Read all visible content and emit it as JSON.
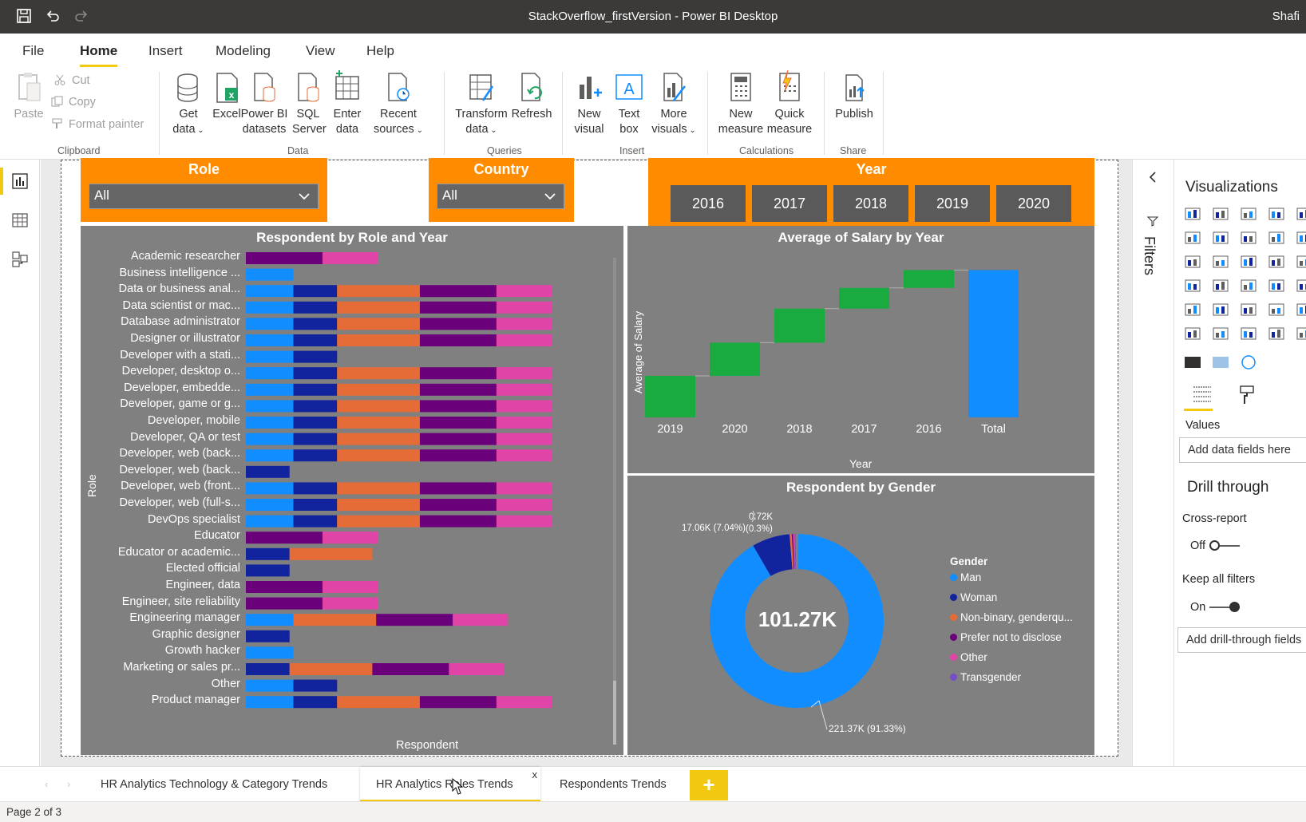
{
  "window": {
    "title": "StackOverflow_firstVersion - Power BI Desktop",
    "user": "Shafi"
  },
  "menu": {
    "tabs": [
      "File",
      "Home",
      "Insert",
      "Modeling",
      "View",
      "Help"
    ],
    "active": "Home"
  },
  "ribbon": {
    "clipboard": {
      "paste": "Paste",
      "cut": "Cut",
      "copy": "Copy",
      "format_painter": "Format painter",
      "label": "Clipboard"
    },
    "data": {
      "get_data": [
        "Get",
        "data"
      ],
      "excel": "Excel",
      "powerbi": [
        "Power BI",
        "datasets"
      ],
      "sql": [
        "SQL",
        "Server"
      ],
      "enter": [
        "Enter",
        "data"
      ],
      "recent": [
        "Recent",
        "sources"
      ],
      "label": "Data"
    },
    "queries": {
      "transform": [
        "Transform",
        "data"
      ],
      "refresh": "Refresh",
      "label": "Queries"
    },
    "insert": {
      "new_visual": [
        "New",
        "visual"
      ],
      "text_box": [
        "Text",
        "box"
      ],
      "more": [
        "More",
        "visuals"
      ],
      "label": "Insert"
    },
    "calc": {
      "new_measure": [
        "New",
        "measure"
      ],
      "quick_measure": [
        "Quick",
        "measure"
      ],
      "label": "Calculations"
    },
    "share": {
      "publish": "Publish",
      "label": "Share"
    }
  },
  "slicers": {
    "role": {
      "title": "Role",
      "value": "All"
    },
    "country": {
      "title": "Country",
      "value": "All"
    },
    "year": {
      "title": "Year",
      "options": [
        "2016",
        "2017",
        "2018",
        "2019",
        "2020"
      ]
    }
  },
  "colors": {
    "y2016": "#118dff",
    "y2017": "#12239e",
    "y2018": "#e66c37",
    "y2019": "#6b007b",
    "y2020": "#e044a7",
    "green": "#1aab40",
    "slicer_orange": "#ff8c00",
    "visual_bg": "#808080"
  },
  "role_chart": {
    "title": "Respondent by Role and Year",
    "xlabel": "Respondent",
    "ylabel": "Role",
    "roles": [
      {
        "label": "Academic researcher",
        "segs": [
          [
            3,
            1.0
          ],
          [
            4,
            0.72
          ]
        ]
      },
      {
        "label": "Business intelligence ...",
        "segs": [
          [
            0,
            0.62
          ]
        ]
      },
      {
        "label": "Data or business anal...",
        "segs": [
          [
            0,
            0.62
          ],
          [
            1,
            0.57
          ],
          [
            2,
            1.08
          ],
          [
            3,
            1.0
          ],
          [
            4,
            0.72
          ]
        ]
      },
      {
        "label": "Data scientist or mac...",
        "segs": [
          [
            0,
            0.62
          ],
          [
            1,
            0.57
          ],
          [
            2,
            1.08
          ],
          [
            3,
            1.0
          ],
          [
            4,
            0.72
          ]
        ]
      },
      {
        "label": "Database administrator",
        "segs": [
          [
            0,
            0.62
          ],
          [
            1,
            0.57
          ],
          [
            2,
            1.08
          ],
          [
            3,
            1.0
          ],
          [
            4,
            0.72
          ]
        ]
      },
      {
        "label": "Designer or illustrator",
        "segs": [
          [
            0,
            0.62
          ],
          [
            1,
            0.57
          ],
          [
            2,
            1.08
          ],
          [
            3,
            1.0
          ],
          [
            4,
            0.72
          ]
        ]
      },
      {
        "label": "Developer with a stati...",
        "segs": [
          [
            0,
            0.62
          ],
          [
            1,
            0.57
          ]
        ]
      },
      {
        "label": "Developer, desktop o...",
        "segs": [
          [
            0,
            0.62
          ],
          [
            1,
            0.57
          ],
          [
            2,
            1.08
          ],
          [
            3,
            1.0
          ],
          [
            4,
            0.72
          ]
        ]
      },
      {
        "label": "Developer, embedde...",
        "segs": [
          [
            0,
            0.62
          ],
          [
            1,
            0.57
          ],
          [
            2,
            1.08
          ],
          [
            3,
            1.0
          ],
          [
            4,
            0.72
          ]
        ]
      },
      {
        "label": "Developer, game or g...",
        "segs": [
          [
            0,
            0.62
          ],
          [
            1,
            0.57
          ],
          [
            2,
            1.08
          ],
          [
            3,
            1.0
          ],
          [
            4,
            0.72
          ]
        ]
      },
      {
        "label": "Developer, mobile",
        "segs": [
          [
            0,
            0.62
          ],
          [
            1,
            0.57
          ],
          [
            2,
            1.08
          ],
          [
            3,
            1.0
          ],
          [
            4,
            0.72
          ]
        ]
      },
      {
        "label": "Developer, QA or test",
        "segs": [
          [
            0,
            0.62
          ],
          [
            1,
            0.57
          ],
          [
            2,
            1.08
          ],
          [
            3,
            1.0
          ],
          [
            4,
            0.72
          ]
        ]
      },
      {
        "label": "Developer, web (back...",
        "segs": [
          [
            0,
            0.62
          ],
          [
            1,
            0.57
          ],
          [
            2,
            1.08
          ],
          [
            3,
            1.0
          ],
          [
            4,
            0.72
          ]
        ]
      },
      {
        "label": "Developer, web (back...",
        "segs": [
          [
            1,
            0.57
          ]
        ]
      },
      {
        "label": "Developer, web (front...",
        "segs": [
          [
            0,
            0.62
          ],
          [
            1,
            0.57
          ],
          [
            2,
            1.08
          ],
          [
            3,
            1.0
          ],
          [
            4,
            0.72
          ]
        ]
      },
      {
        "label": "Developer, web (full-s...",
        "segs": [
          [
            0,
            0.62
          ],
          [
            1,
            0.57
          ],
          [
            2,
            1.08
          ],
          [
            3,
            1.0
          ],
          [
            4,
            0.72
          ]
        ]
      },
      {
        "label": "DevOps specialist",
        "segs": [
          [
            0,
            0.62
          ],
          [
            1,
            0.57
          ],
          [
            2,
            1.08
          ],
          [
            3,
            1.0
          ],
          [
            4,
            0.72
          ]
        ]
      },
      {
        "label": "Educator",
        "segs": [
          [
            3,
            1.0
          ],
          [
            4,
            0.72
          ]
        ]
      },
      {
        "label": "Educator or academic...",
        "segs": [
          [
            1,
            0.57
          ],
          [
            2,
            1.08
          ]
        ]
      },
      {
        "label": "Elected official",
        "segs": [
          [
            1,
            0.57
          ]
        ]
      },
      {
        "label": "Engineer, data",
        "segs": [
          [
            3,
            1.0
          ],
          [
            4,
            0.72
          ]
        ]
      },
      {
        "label": "Engineer, site reliability",
        "segs": [
          [
            3,
            1.0
          ],
          [
            4,
            0.72
          ]
        ]
      },
      {
        "label": "Engineering manager",
        "segs": [
          [
            0,
            0.62
          ],
          [
            2,
            1.08
          ],
          [
            3,
            1.0
          ],
          [
            4,
            0.72
          ]
        ]
      },
      {
        "label": "Graphic designer",
        "segs": [
          [
            1,
            0.57
          ]
        ]
      },
      {
        "label": "Growth hacker",
        "segs": [
          [
            0,
            0.62
          ]
        ]
      },
      {
        "label": "Marketing or sales pr...",
        "segs": [
          [
            1,
            0.57
          ],
          [
            2,
            1.08
          ],
          [
            3,
            1.0
          ],
          [
            4,
            0.72
          ]
        ]
      },
      {
        "label": "Other",
        "segs": [
          [
            0,
            0.62
          ],
          [
            1,
            0.57
          ]
        ]
      },
      {
        "label": "Product manager",
        "segs": [
          [
            0,
            0.62
          ],
          [
            1,
            0.57
          ],
          [
            2,
            1.08
          ],
          [
            3,
            1.0
          ],
          [
            4,
            0.72
          ]
        ]
      }
    ]
  },
  "salary_chart": {
    "title": "Average of Salary by Year",
    "xlabel": "Year",
    "ylabel": "Average of Salary",
    "categories": [
      "2019",
      "2020",
      "2018",
      "2017",
      "2016",
      "Total"
    ],
    "steps": [
      [
        0,
        1
      ],
      [
        1,
        1.8
      ],
      [
        1.8,
        2.62
      ],
      [
        2.62,
        3.12
      ],
      [
        3.12,
        3.55
      ],
      [
        0,
        3.55
      ]
    ]
  },
  "gender_chart": {
    "title": "Respondent by Gender",
    "center_label": "101.27K",
    "legend_title": "Gender",
    "slices": [
      {
        "name": "Man",
        "share": 0.9133,
        "color": "#118dff"
      },
      {
        "name": "Woman",
        "share": 0.0704,
        "color": "#12239e"
      },
      {
        "name": "Non-binary, genderqu...",
        "share": 0.004,
        "color": "#e66c37"
      },
      {
        "name": "Prefer not to disclose",
        "share": 0.0023,
        "color": "#6b007b"
      },
      {
        "name": "Other",
        "share": 0.003,
        "color": "#e044a7"
      },
      {
        "name": "Transgender",
        "share": 0.0015,
        "color": "#744ec2"
      }
    ],
    "labels": {
      "man": "221.37K (91.33%)",
      "woman": "17.06K (7.04%)",
      "small_top": "0.72K",
      "small_bottom": "(0.3%)"
    }
  },
  "viz_pane": {
    "title": "Visualizations",
    "filters": "Filters",
    "values": "Values",
    "add_fields": "Add data fields here",
    "drill": "Drill through",
    "cross_report": "Cross-report",
    "cross_state": "Off",
    "keep_filters": "Keep all filters",
    "keep_state": "On",
    "add_drill": "Add drill-through fields"
  },
  "pages": {
    "tabs": [
      "HR Analytics Technology & Category Trends",
      "HR Analytics Roles Trends",
      "Respondents Trends"
    ],
    "active": 1,
    "status": "Page 2 of 3",
    "close": "x",
    "add": "+"
  }
}
